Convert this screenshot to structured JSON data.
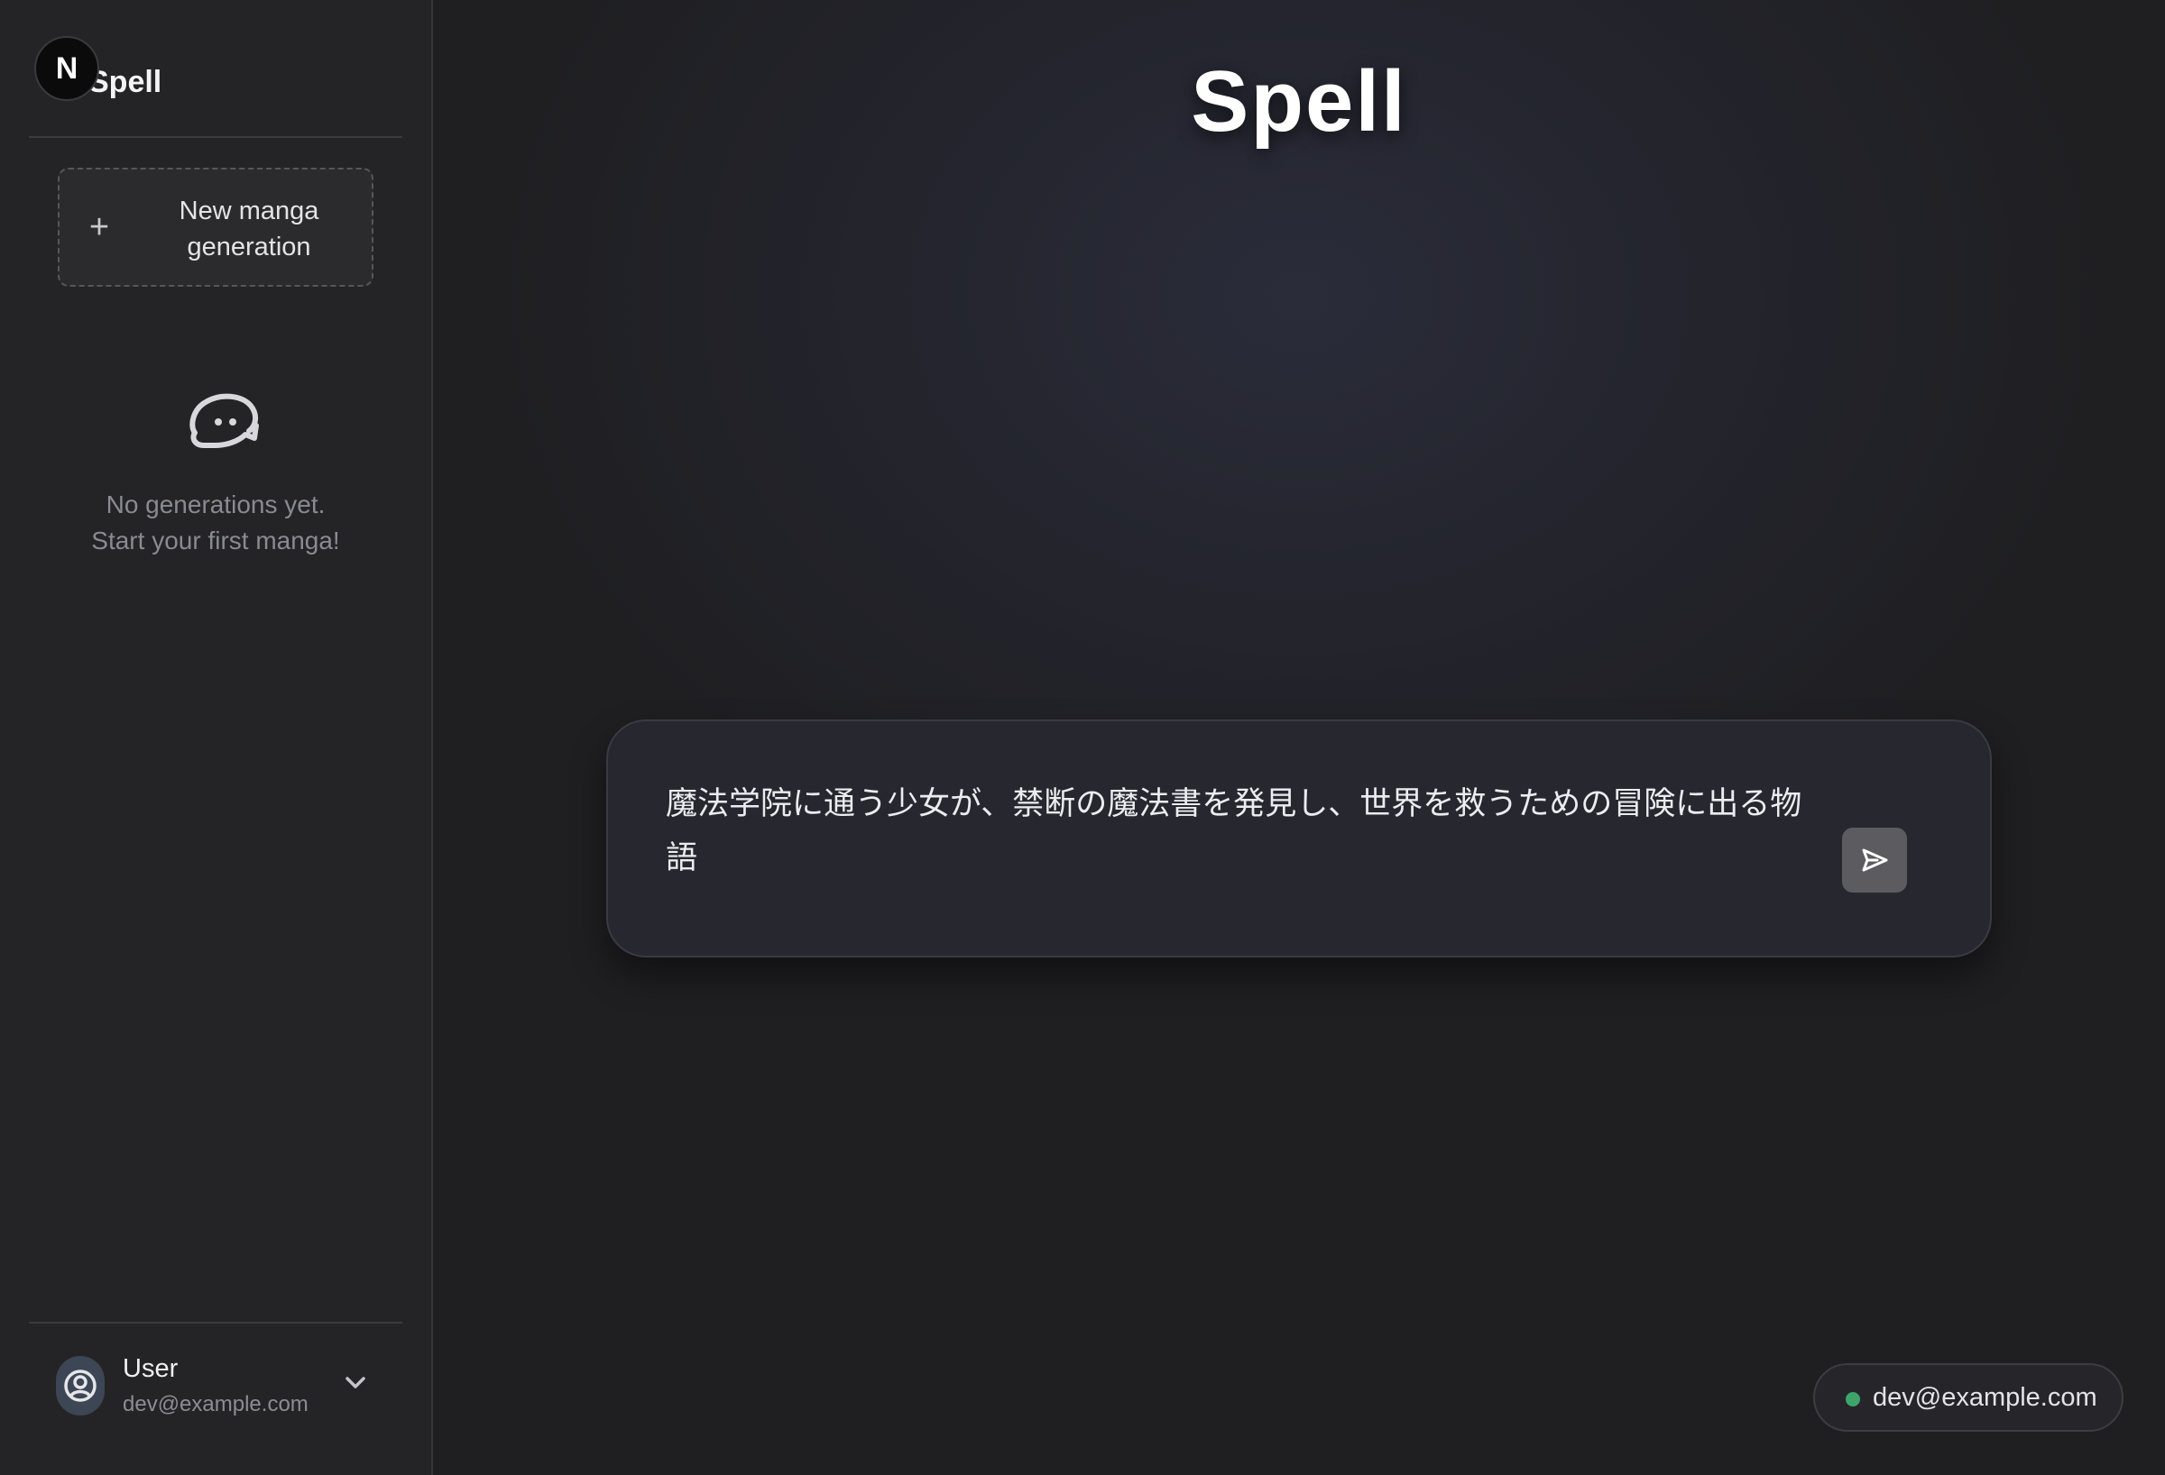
{
  "brand": {
    "title": "Spell",
    "badge": "N"
  },
  "sidebar": {
    "new_button_label": "New manga generation",
    "empty_line1": "No generations yet.",
    "empty_line2": "Start your first manga!",
    "empty_icon": "chat-bubble-face-icon",
    "user": {
      "name": "User",
      "email": "dev@example.com",
      "avatar_icon": "user-circle-icon",
      "menu_icon": "chevron-down-icon"
    }
  },
  "main": {
    "title": "Spell",
    "prompt_value": "魔法学院に通う少女が、禁断の魔法書を発見し、世界を救うための冒険に出る物語",
    "send_icon": "send-icon"
  },
  "status": {
    "email": "dev@example.com",
    "dot_color": "#3ea56a"
  }
}
